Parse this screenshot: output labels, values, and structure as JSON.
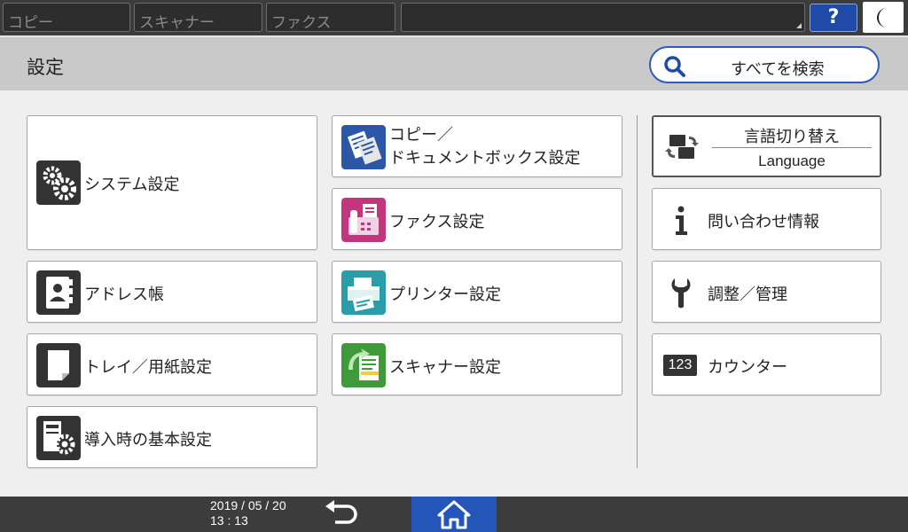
{
  "topbar": {
    "tabs": [
      "コピー",
      "スキャナー",
      "ファクス"
    ],
    "help_label": "?",
    "colors": {
      "help": "#1f4aa8"
    }
  },
  "header": {
    "title": "設定",
    "search_label": "すべてを検索"
  },
  "menu_left": [
    {
      "label": "システム設定",
      "icon": "system-settings-gear-icon"
    },
    {
      "label": "アドレス帳",
      "icon": "address-book-icon"
    },
    {
      "label": "トレイ／用紙設定",
      "icon": "tray-paper-icon"
    },
    {
      "label": "導入時の基本設定",
      "icon": "initial-setup-icon"
    }
  ],
  "menu_middle": [
    {
      "label_line1": "コピー／",
      "label_line2": "ドキュメントボックス設定",
      "icon": "copier-document-box-icon"
    },
    {
      "label": "ファクス設定",
      "icon": "fax-icon"
    },
    {
      "label": "プリンター設定",
      "icon": "printer-icon"
    },
    {
      "label": "スキャナー設定",
      "icon": "scanner-icon"
    }
  ],
  "menu_right": {
    "language": {
      "label_ja": "言語切り替え",
      "label_en": "Language",
      "icon": "language-switch-icon"
    },
    "items": [
      {
        "label": "問い合わせ情報",
        "icon": "info-icon"
      },
      {
        "label": "調整／管理",
        "icon": "wrench-icon"
      },
      {
        "label": "カウンター",
        "icon": "counter-123-icon",
        "icon_text": "123"
      }
    ]
  },
  "footer": {
    "date": "2019 / 05 / 20",
    "time": "13 : 13",
    "colors": {
      "home": "#2356b8"
    }
  }
}
